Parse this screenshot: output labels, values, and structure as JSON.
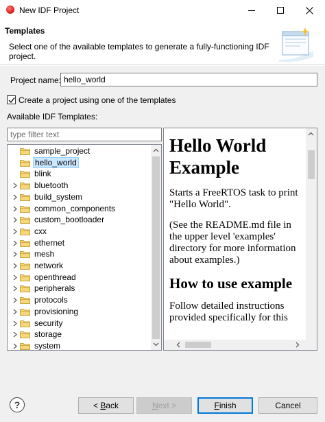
{
  "window": {
    "title": "New IDF Project",
    "app_icon": "espressif-red-dot-icon"
  },
  "header": {
    "title": "Templates",
    "description": "Select one of the available templates to generate a fully-functioning IDF project."
  },
  "form": {
    "project_name_label": "Project name:",
    "project_name_value": "hello_world",
    "create_from_template_label": "Create a project using one of the templates",
    "create_from_template_checked": true,
    "available_templates_label": "Available IDF Templates:",
    "filter_placeholder": "type filter text"
  },
  "tree": {
    "items": [
      {
        "label": "sample_project",
        "expandable": false,
        "selected": false
      },
      {
        "label": "hello_world",
        "expandable": false,
        "selected": true
      },
      {
        "label": "blink",
        "expandable": false,
        "selected": false
      },
      {
        "label": "bluetooth",
        "expandable": true,
        "selected": false
      },
      {
        "label": "build_system",
        "expandable": true,
        "selected": false
      },
      {
        "label": "common_components",
        "expandable": true,
        "selected": false
      },
      {
        "label": "custom_bootloader",
        "expandable": true,
        "selected": false
      },
      {
        "label": "cxx",
        "expandable": true,
        "selected": false
      },
      {
        "label": "ethernet",
        "expandable": true,
        "selected": false
      },
      {
        "label": "mesh",
        "expandable": true,
        "selected": false
      },
      {
        "label": "network",
        "expandable": true,
        "selected": false
      },
      {
        "label": "openthread",
        "expandable": true,
        "selected": false
      },
      {
        "label": "peripherals",
        "expandable": true,
        "selected": false
      },
      {
        "label": "protocols",
        "expandable": true,
        "selected": false
      },
      {
        "label": "provisioning",
        "expandable": true,
        "selected": false
      },
      {
        "label": "security",
        "expandable": true,
        "selected": false
      },
      {
        "label": "storage",
        "expandable": true,
        "selected": false
      },
      {
        "label": "system",
        "expandable": true,
        "selected": false
      }
    ]
  },
  "preview": {
    "heading": "Hello World Example",
    "paragraph1": "Starts a FreeRTOS task to print \"Hello World\".",
    "paragraph2": "(See the README.md file in the upper level 'examples' directory for more information about examples.)",
    "subheading": "How to use example",
    "paragraph3": "Follow detailed instructions provided specifically for this"
  },
  "buttons": {
    "back_prefix": "< ",
    "back_mnemonic": "B",
    "back_rest": "ack",
    "next_mnemonic": "N",
    "next_rest": "ext >",
    "finish_mnemonic": "F",
    "finish_rest": "inish",
    "cancel": "Cancel",
    "help": "?"
  },
  "colors": {
    "selection_bg": "#cce8ff",
    "default_button_border": "#0078d7",
    "folder": "#e8b94a"
  }
}
